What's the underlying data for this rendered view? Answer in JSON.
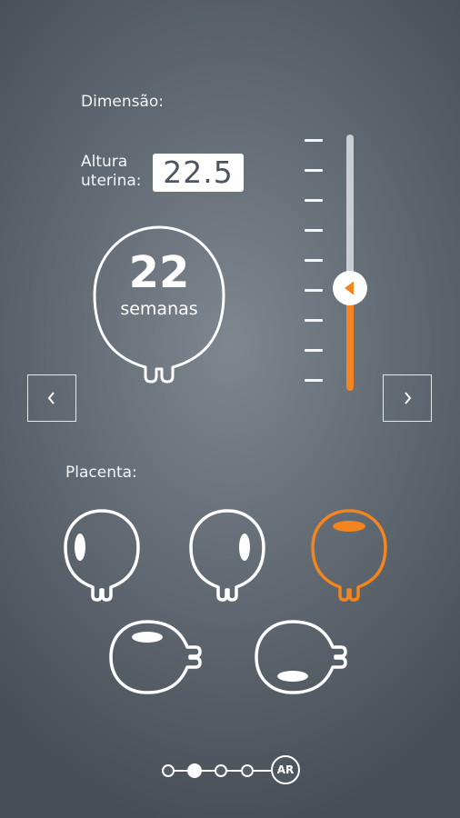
{
  "dimension": {
    "title": "Dimensão:"
  },
  "uterine_height": {
    "label_line1": "Altura",
    "label_line2": "uterina:",
    "value": "22.5"
  },
  "gestation": {
    "weeks": "22",
    "unit": "semanas"
  },
  "slider": {
    "level_fraction": 0.6,
    "tick_count": 9
  },
  "nav": {
    "prev_icon": "chevron-left-icon",
    "next_icon": "chevron-right-icon"
  },
  "placenta": {
    "title": "Placenta:",
    "options": [
      {
        "id": "left",
        "selected": false
      },
      {
        "id": "right",
        "selected": false
      },
      {
        "id": "fundal",
        "selected": true
      },
      {
        "id": "anterior",
        "selected": false
      },
      {
        "id": "posterior",
        "selected": false
      }
    ]
  },
  "pager": {
    "total_dots": 4,
    "active_index": 1,
    "badge": "AR"
  },
  "colors": {
    "accent": "#f2851f",
    "background": "#5f6770",
    "foreground": "#ffffff"
  }
}
